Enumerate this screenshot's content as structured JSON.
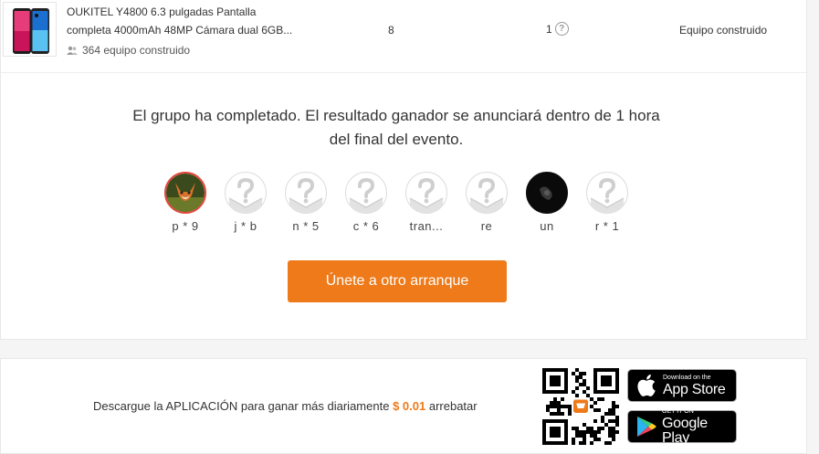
{
  "product": {
    "title_line1": "OUKITEL Y4800 6.3 pulgadas Pantalla",
    "title_line2": "completa 4000mAh 48MP Cámara dual 6GB...",
    "built_count": "364 equipo construido",
    "participants": "8",
    "quantity": "1",
    "status": "Equipo construido"
  },
  "message": "El grupo ha completado. El resultado ganador se anunciará dentro de 1 hora del final del evento.",
  "members": [
    {
      "name": "p * 9",
      "avatar": "fox-photo"
    },
    {
      "name": "j * b",
      "avatar": "placeholder"
    },
    {
      "name": "n * 5",
      "avatar": "placeholder"
    },
    {
      "name": "c * 6",
      "avatar": "placeholder"
    },
    {
      "name": "tran...",
      "avatar": "placeholder"
    },
    {
      "name": "re",
      "avatar": "placeholder"
    },
    {
      "name": "un",
      "avatar": "dark-photo"
    },
    {
      "name": "r * 1",
      "avatar": "placeholder"
    }
  ],
  "join_button": "Únete a otro arranque",
  "download": {
    "text_before": "Descargue la APLICACIÓN para ganar más diariamente",
    "price": "$ 0.01",
    "text_after": "arrebatar"
  },
  "stores": {
    "apple_small": "Download on the",
    "apple_big": "App Store",
    "google_small": "GET IT ON",
    "google_big": "Google Play"
  },
  "colors": {
    "accent": "#ee7a1a",
    "owner_ring": "#e3473b"
  }
}
